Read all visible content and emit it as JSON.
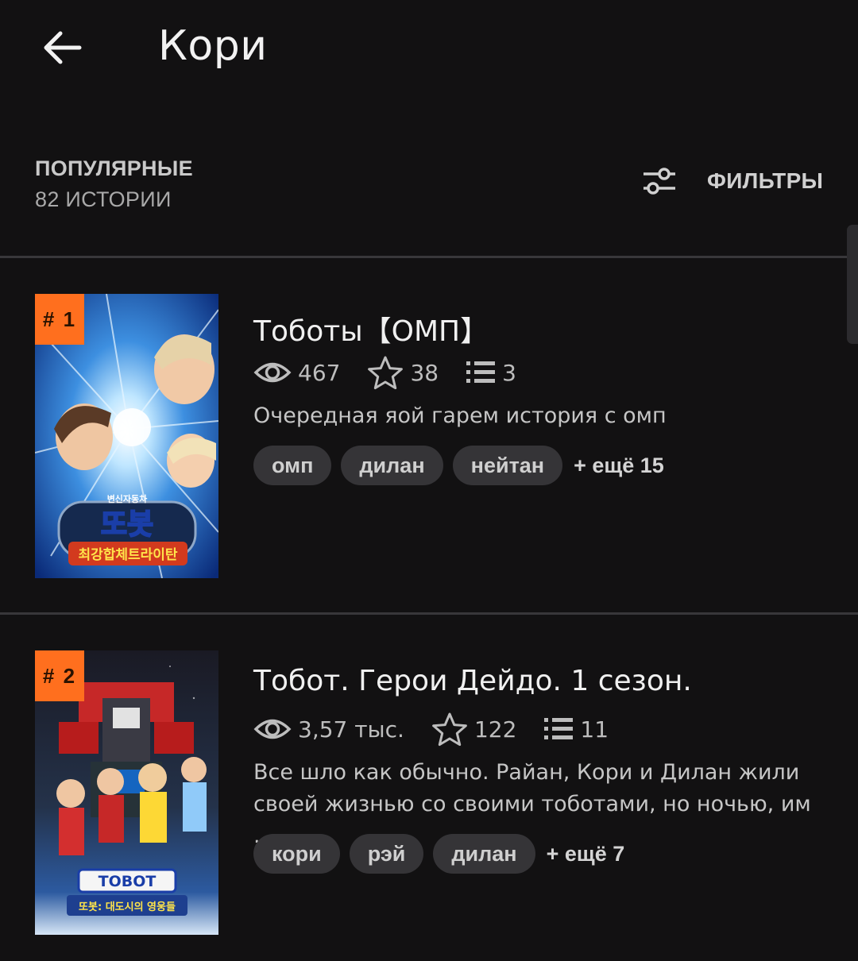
{
  "header": {
    "title": "Кори",
    "back_icon": "arrow-left-icon"
  },
  "section": {
    "label": "ПОПУЛЯРНЫЕ",
    "count": "82 ИСТОРИИ",
    "filters_label": "ФИЛЬТРЫ",
    "filters_icon": "sliders-icon"
  },
  "colors": {
    "background": "#121112",
    "rank_badge": "#ff6f1e",
    "tag_bg": "#353437",
    "divider": "#38373a"
  },
  "stories": [
    {
      "rank": "# 1",
      "title": "Тоботы【ОМП】",
      "reads": "467",
      "votes": "38",
      "parts": "3",
      "description": "Очередная яой гарем история с омп",
      "tags": [
        "омп",
        "дилан",
        "нейтан"
      ],
      "more": "+ ещё 15",
      "cover_logo_top": "변신자동차",
      "cover_logo_main": "또봇",
      "cover_logo_sub": "최강합체트라이탄"
    },
    {
      "rank": "# 2",
      "title": "Тобот. Герои Дейдо. 1 сезон.",
      "reads": "3,57 тыс.",
      "votes": "122",
      "parts": "11",
      "description": "Все шло как обычно. Райан, Кори и Дилан жили своей жизнью со своими тоботами, но ночью, им ...",
      "tags": [
        "кори",
        "рэй",
        "дилан"
      ],
      "more": "+ ещё 7",
      "cover_logo_main": "TOBOT",
      "cover_logo_sub": "또봇: 대도시의 영웅들"
    }
  ]
}
